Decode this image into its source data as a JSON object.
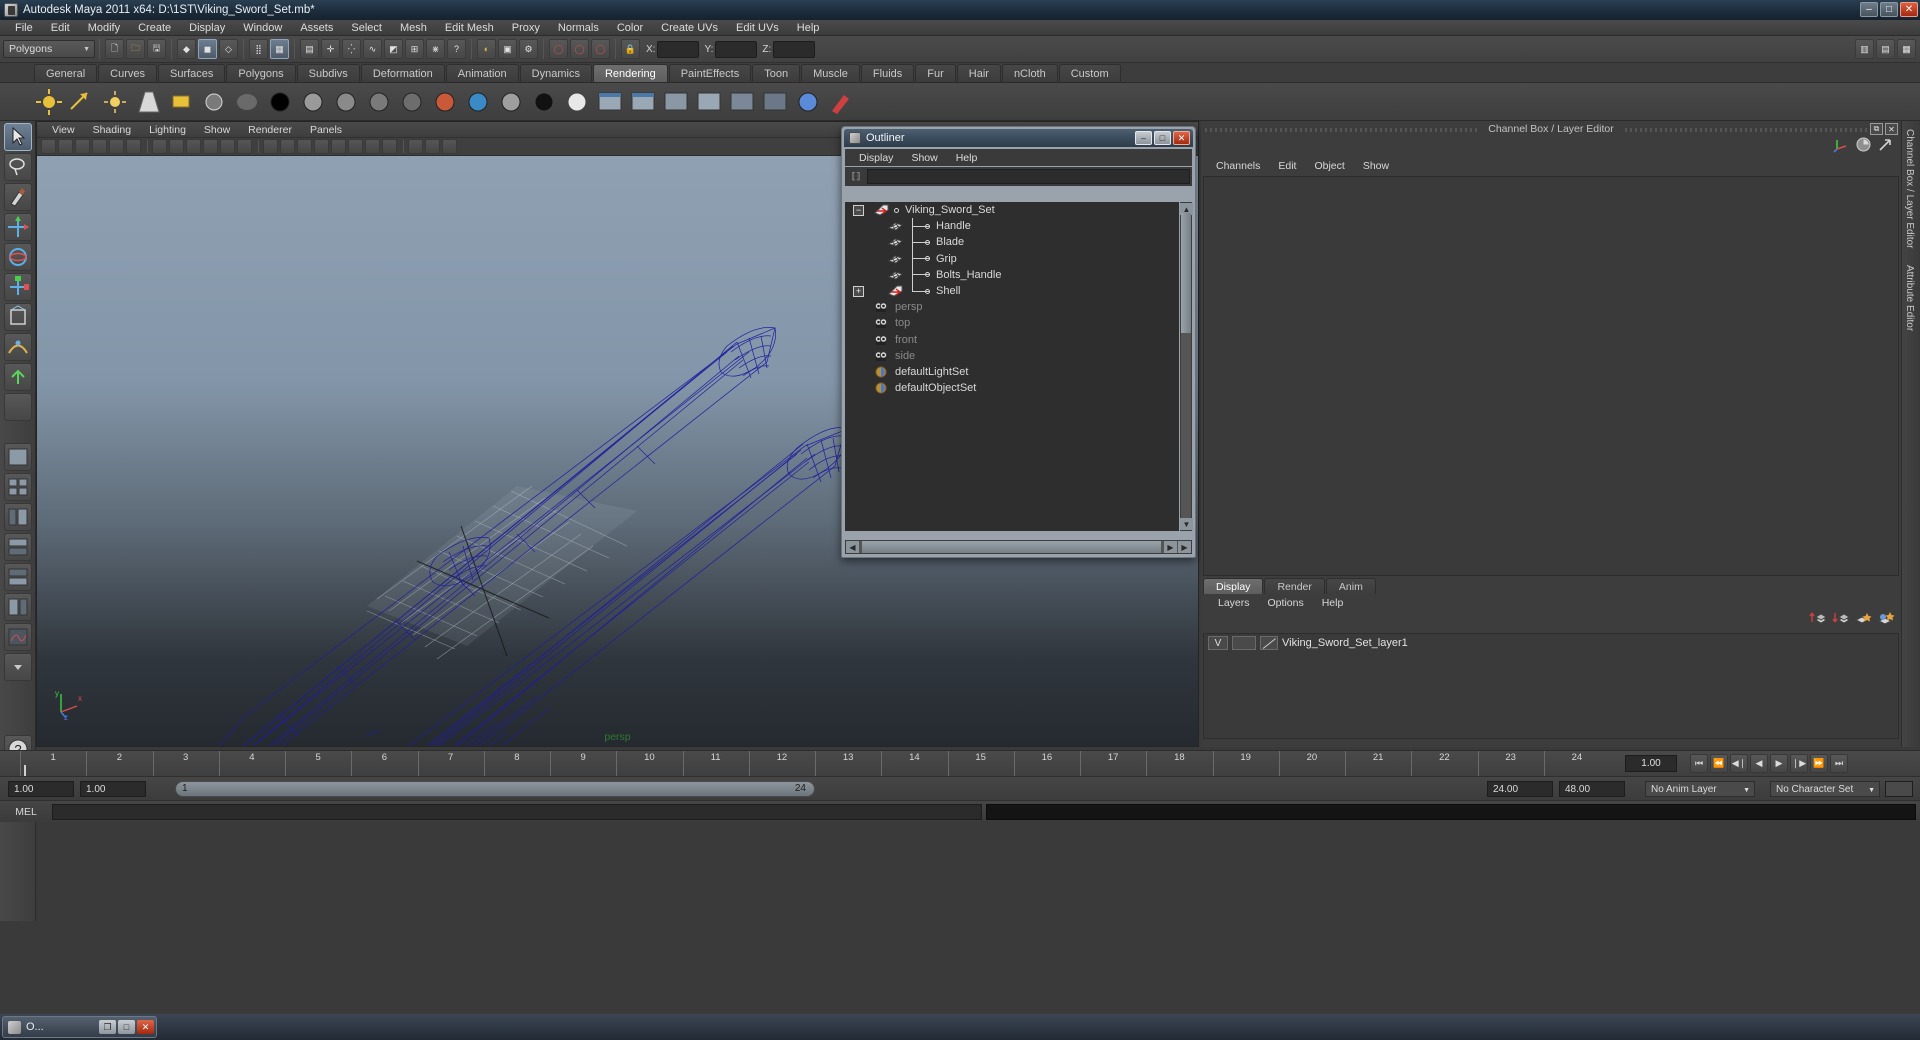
{
  "window": {
    "title": "Autodesk Maya 2011 x64: D:\\1ST\\Viking_Sword_Set.mb*",
    "app_icon": "maya-icon",
    "minimize": "–",
    "maximize": "□",
    "close": "✕"
  },
  "menubar": {
    "items": [
      "File",
      "Edit",
      "Modify",
      "Create",
      "Display",
      "Window",
      "Assets",
      "Select",
      "Mesh",
      "Edit Mesh",
      "Proxy",
      "Normals",
      "Color",
      "Create UVs",
      "Edit UVs",
      "Help"
    ]
  },
  "statusline": {
    "mode_selector": "Polygons",
    "coord_labels": [
      "X:",
      "Y:",
      "Z:"
    ]
  },
  "shelf": {
    "tabs": [
      "General",
      "Curves",
      "Surfaces",
      "Polygons",
      "Subdivs",
      "Deformation",
      "Animation",
      "Dynamics",
      "Rendering",
      "PaintEffects",
      "Toon",
      "Muscle",
      "Fluids",
      "Fur",
      "Hair",
      "nCloth",
      "Custom"
    ],
    "active_tab": "Rendering"
  },
  "viewport": {
    "menu": [
      "View",
      "Shading",
      "Lighting",
      "Show",
      "Renderer",
      "Panels"
    ],
    "camera_label": "persp",
    "camera_label_color": "#2f7a2f",
    "axis_labels": {
      "x": "x",
      "y": "y",
      "z": "z"
    },
    "background_top": "#8fa0b2",
    "wireframe_color": "#1f1f9e"
  },
  "outliner": {
    "title": "Outliner",
    "menu": [
      "Display",
      "Show",
      "Help"
    ],
    "search_value": "",
    "items": [
      {
        "label": "Viking_Sword_Set",
        "icon": "transform-icon",
        "expander": "−",
        "depth": 0,
        "dim": false
      },
      {
        "label": "Handle",
        "icon": "mesh-icon",
        "expander": "",
        "depth": 1,
        "dim": false
      },
      {
        "label": "Blade",
        "icon": "mesh-icon",
        "expander": "",
        "depth": 1,
        "dim": false
      },
      {
        "label": "Grip",
        "icon": "mesh-icon",
        "expander": "",
        "depth": 1,
        "dim": false
      },
      {
        "label": "Bolts_Handle",
        "icon": "mesh-icon",
        "expander": "",
        "depth": 1,
        "dim": false
      },
      {
        "label": "Shell",
        "icon": "transform-icon",
        "expander": "+",
        "depth": 1,
        "dim": false
      },
      {
        "label": "persp",
        "icon": "camera-icon",
        "expander": "",
        "depth": 0,
        "dim": true
      },
      {
        "label": "top",
        "icon": "camera-icon",
        "expander": "",
        "depth": 0,
        "dim": true
      },
      {
        "label": "front",
        "icon": "camera-icon",
        "expander": "",
        "depth": 0,
        "dim": true
      },
      {
        "label": "side",
        "icon": "camera-icon",
        "expander": "",
        "depth": 0,
        "dim": true
      },
      {
        "label": "defaultLightSet",
        "icon": "set-icon",
        "expander": "",
        "depth": 0,
        "dim": false
      },
      {
        "label": "defaultObjectSet",
        "icon": "set-icon",
        "expander": "",
        "depth": 0,
        "dim": false
      }
    ],
    "window_buttons": {
      "minimize": "–",
      "maximize": "□",
      "close": "✕"
    }
  },
  "channelbox": {
    "header_title": "Channel Box / Layer Editor",
    "header_buttons": [
      "⧉",
      "✕"
    ],
    "menu": [
      "Channels",
      "Edit",
      "Object",
      "Show"
    ],
    "vertical_tabs": [
      "Channel Box / Layer Editor",
      "Attribute Editor"
    ]
  },
  "layer_editor": {
    "tabs": [
      "Display",
      "Render",
      "Anim"
    ],
    "active_tab": "Display",
    "menu": [
      "Layers",
      "Options",
      "Help"
    ],
    "layers": [
      {
        "visibility": "V",
        "display_type": "",
        "name": "Viking_Sword_Set_layer1"
      }
    ]
  },
  "timeslider": {
    "ticks": [
      1,
      2,
      3,
      4,
      5,
      6,
      7,
      8,
      9,
      10,
      11,
      12,
      13,
      14,
      15,
      16,
      17,
      18,
      19,
      20,
      21,
      22,
      23,
      24
    ],
    "current_frame": "1.00",
    "playback_buttons": [
      "⏮",
      "⏪",
      "◀❘",
      "◀",
      "▶",
      "❘▶",
      "⏩",
      "⏭"
    ]
  },
  "rangeslider": {
    "start_field": "1.00",
    "start_field2": "1.00",
    "range_start": "1",
    "range_end": "24",
    "end_field": "24.00",
    "end_field2": "48.00",
    "anim_layer": "No Anim Layer",
    "character_set": "No Character Set"
  },
  "commandline": {
    "label": "MEL",
    "input_value": "",
    "output_value": ""
  },
  "taskbar": {
    "item_label": "O...",
    "buttons": {
      "restore": "❐",
      "maximize": "□",
      "close": "✕"
    }
  }
}
